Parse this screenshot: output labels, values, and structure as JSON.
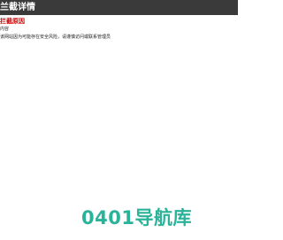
{
  "header": {
    "title": "兰截详情"
  },
  "content": {
    "reason_label": "拦截原因",
    "line1": "内容",
    "line2": "该网站因为可能存在安全风险，请谨慎访问或联系管理员"
  },
  "watermark": {
    "digits": "0401",
    "name": "导航库"
  },
  "colors": {
    "header_bg": "#3a3a3a",
    "reason_red": "#cc0000",
    "watermark_teal": "#2bb39a"
  }
}
